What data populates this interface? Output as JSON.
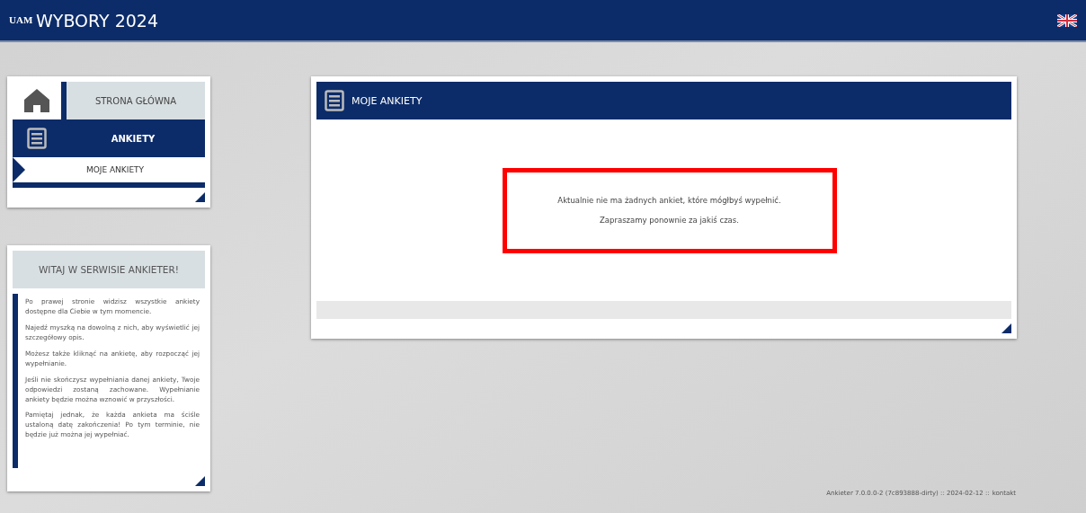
{
  "header": {
    "title": "WYBORY 2024",
    "logo": "UAM"
  },
  "nav": {
    "items": [
      {
        "label": "STRONA GŁÓWNA",
        "kind": "home",
        "selected": false
      },
      {
        "label": "ANKIETY",
        "kind": "section",
        "selected": true
      },
      {
        "label": "MOJE ANKIETY",
        "kind": "sub",
        "selected": true
      }
    ]
  },
  "welcome": {
    "title": "WITAJ W SERWISIE ANKIETER!",
    "paragraphs": [
      "Po prawej stronie widzisz wszystkie ankiety dostępne dla Ciebie w tym momencie.",
      "Najedź myszką na dowolną z nich, aby wyświetlić jej szczegółowy opis.",
      "Możesz także kliknąć na ankietę, aby rozpocząć jej wypełnianie.",
      "Jeśli nie skończysz wypełniania danej ankiety, Twoje odpowiedzi zostaną zachowane. Wypełnianie ankiety będzie można wznowić w przyszłości.",
      "Pamiętaj jednak, że każda ankieta ma ściśle ustaloną datę zakończenia! Po tym terminie, nie będzie już można jej wypełniać."
    ]
  },
  "main": {
    "title": "MOJE ANKIETY",
    "messages": [
      "Aktualnie nie ma żadnych ankiet, które mógłbyś wypełnić.",
      "Zapraszamy ponownie za jakiś czas."
    ]
  },
  "footer": {
    "version": "Ankieter 7.0.0.0-2 (7c893888-dirty) :: 2024-02-12 ::",
    "link": "kontakt"
  }
}
